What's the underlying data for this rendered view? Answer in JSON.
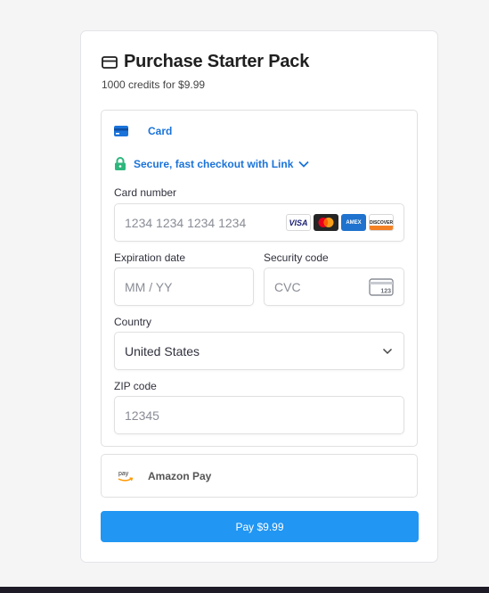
{
  "modal": {
    "title": "Purchase Starter Pack",
    "subtitle": "1000 credits for $9.99"
  },
  "payment": {
    "card_tab_label": "Card",
    "link_label": "Secure, fast checkout with Link",
    "card_number": {
      "label": "Card number",
      "placeholder": "1234 1234 1234 1234",
      "value": ""
    },
    "brands": [
      "VISA",
      "Mastercard",
      "AMEX",
      "DISCOVER"
    ],
    "expiration": {
      "label": "Expiration date",
      "placeholder": "MM / YY",
      "value": ""
    },
    "security": {
      "label": "Security code",
      "placeholder": "CVC",
      "value": "",
      "icon_text": "123"
    },
    "country": {
      "label": "Country",
      "value": "United States"
    },
    "zip": {
      "label": "ZIP code",
      "placeholder": "12345",
      "value": ""
    },
    "amazon_label": "Amazon Pay",
    "amazon_icon_text": "pay"
  },
  "pay_button_label": "Pay $9.99",
  "colors": {
    "accent": "#2196f3",
    "link_blue": "#1a73d9",
    "lock_green": "#2eb67d"
  }
}
